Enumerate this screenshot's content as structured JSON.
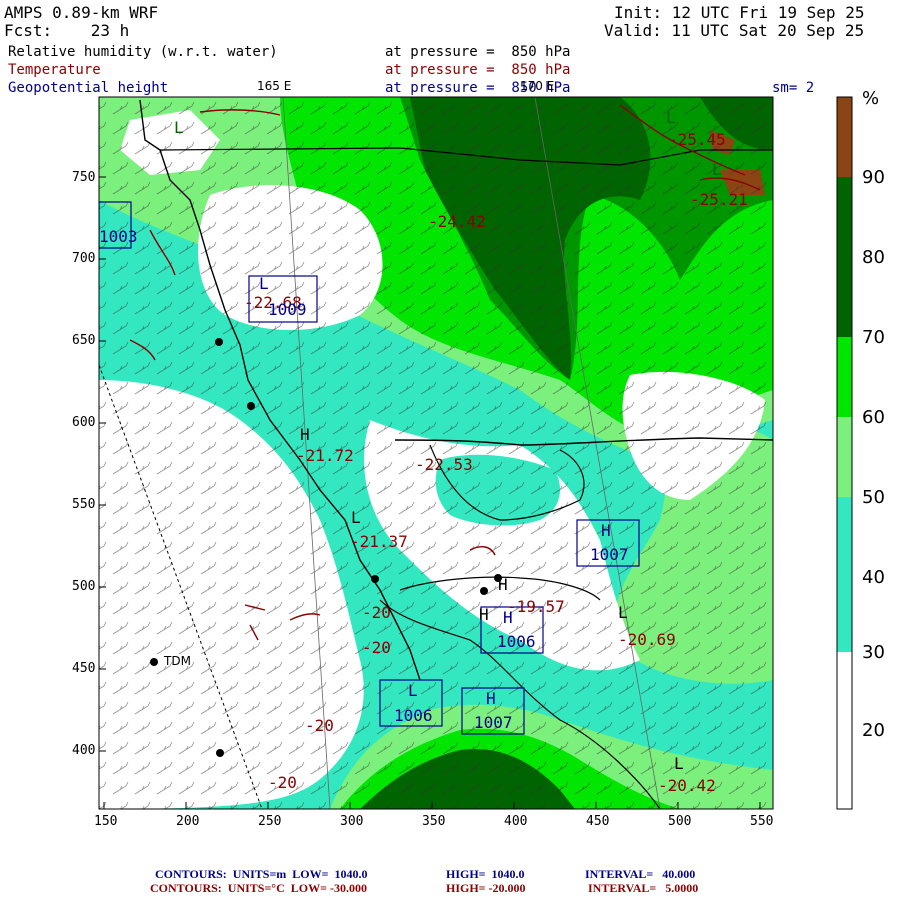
{
  "header": {
    "model": "AMPS 0.89-km WRF",
    "forecast": "Fcst:    23 h",
    "init": "Init: 12 UTC Fri 19 Sep 25",
    "valid": "Valid: 11 UTC Sat 20 Sep 25",
    "field1": "Relative humidity (w.r.t. water)",
    "field2": "Temperature",
    "field3": "Geopotential height",
    "pressure1": "at pressure =  850 hPa",
    "pressure2": "at pressure =  850 hPa",
    "pressure3": "at pressure =  850 hPa",
    "meridian_left": "165 E",
    "meridian_right": "170 E",
    "smoothing": "sm= 2"
  },
  "colors": {
    "field1": "#000000",
    "field2": "#8b0000",
    "field3": "#00008b",
    "rh_bins": [
      "#ffffff",
      "#ffffff",
      "#33e8c0",
      "#7cf07c",
      "#00e600",
      "#009600",
      "#006400",
      "#8b4513"
    ]
  },
  "axes": {
    "x_ticks": [
      "150",
      "200",
      "250",
      "300",
      "350",
      "400",
      "450",
      "500",
      "550"
    ],
    "y_ticks": [
      "750",
      "700",
      "650",
      "600",
      "550",
      "500",
      "450",
      "400"
    ]
  },
  "colorbar": {
    "unit": "%",
    "labels": [
      "90",
      "80",
      "70",
      "60",
      "50",
      "40",
      "30",
      "20"
    ]
  },
  "map_labels": {
    "station": "TDM",
    "temps": [
      "-25.45",
      "-25.21",
      "-24.42",
      "-22.68",
      "-21.72",
      "-22.53",
      "-21.37",
      "-19.57",
      "-20.69",
      "-20.42",
      "-20",
      "-20",
      "-20",
      "-20"
    ],
    "heights": [
      "1009",
      "1007",
      "1006",
      "1006",
      "1007",
      "1003"
    ],
    "pressure_centers": [
      "L",
      "L",
      "L",
      "H",
      "H",
      "H",
      "L",
      "H",
      "H",
      "L",
      "L",
      "H",
      "L",
      "H",
      "L"
    ]
  },
  "footer": {
    "line1": {
      "label": "CONTOURS:  UNITS=m  LOW=  1040.0",
      "high": "HIGH=  1040.0",
      "interval": "INTERVAL=   40.000"
    },
    "line2": {
      "label": "CONTOURS:  UNITS=°C  LOW= -30.000",
      "high": "HIGH= -20.000",
      "interval": "INTERVAL=   5.0000"
    }
  }
}
